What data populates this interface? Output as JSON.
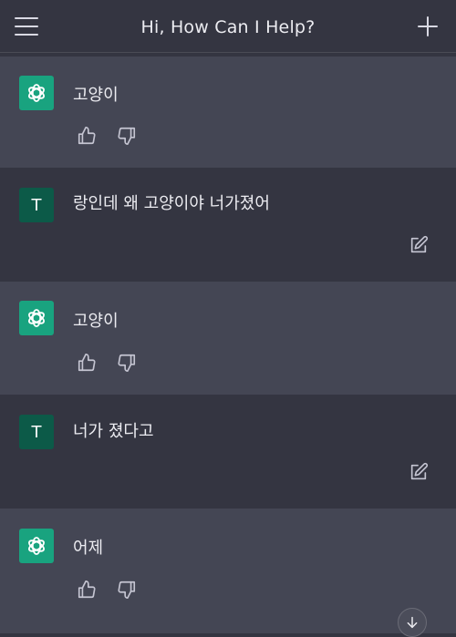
{
  "header": {
    "title": "Hi, How Can I Help?",
    "menu_icon": "hamburger-menu-icon",
    "new_chat_icon": "plus-icon"
  },
  "colors": {
    "background": "#343541",
    "ai_message_background": "#444654",
    "ai_avatar": "#19a37f",
    "user_avatar": "#0c5a48"
  },
  "messages": [
    {
      "role": "assistant",
      "text": "고양이"
    },
    {
      "role": "user",
      "avatar_letter": "T",
      "text": "랑인데 왜 고양이야 너가졌어"
    },
    {
      "role": "assistant",
      "text": "고양이"
    },
    {
      "role": "user",
      "avatar_letter": "T",
      "text": "너가 졌다고"
    },
    {
      "role": "assistant",
      "text": "어제"
    }
  ]
}
